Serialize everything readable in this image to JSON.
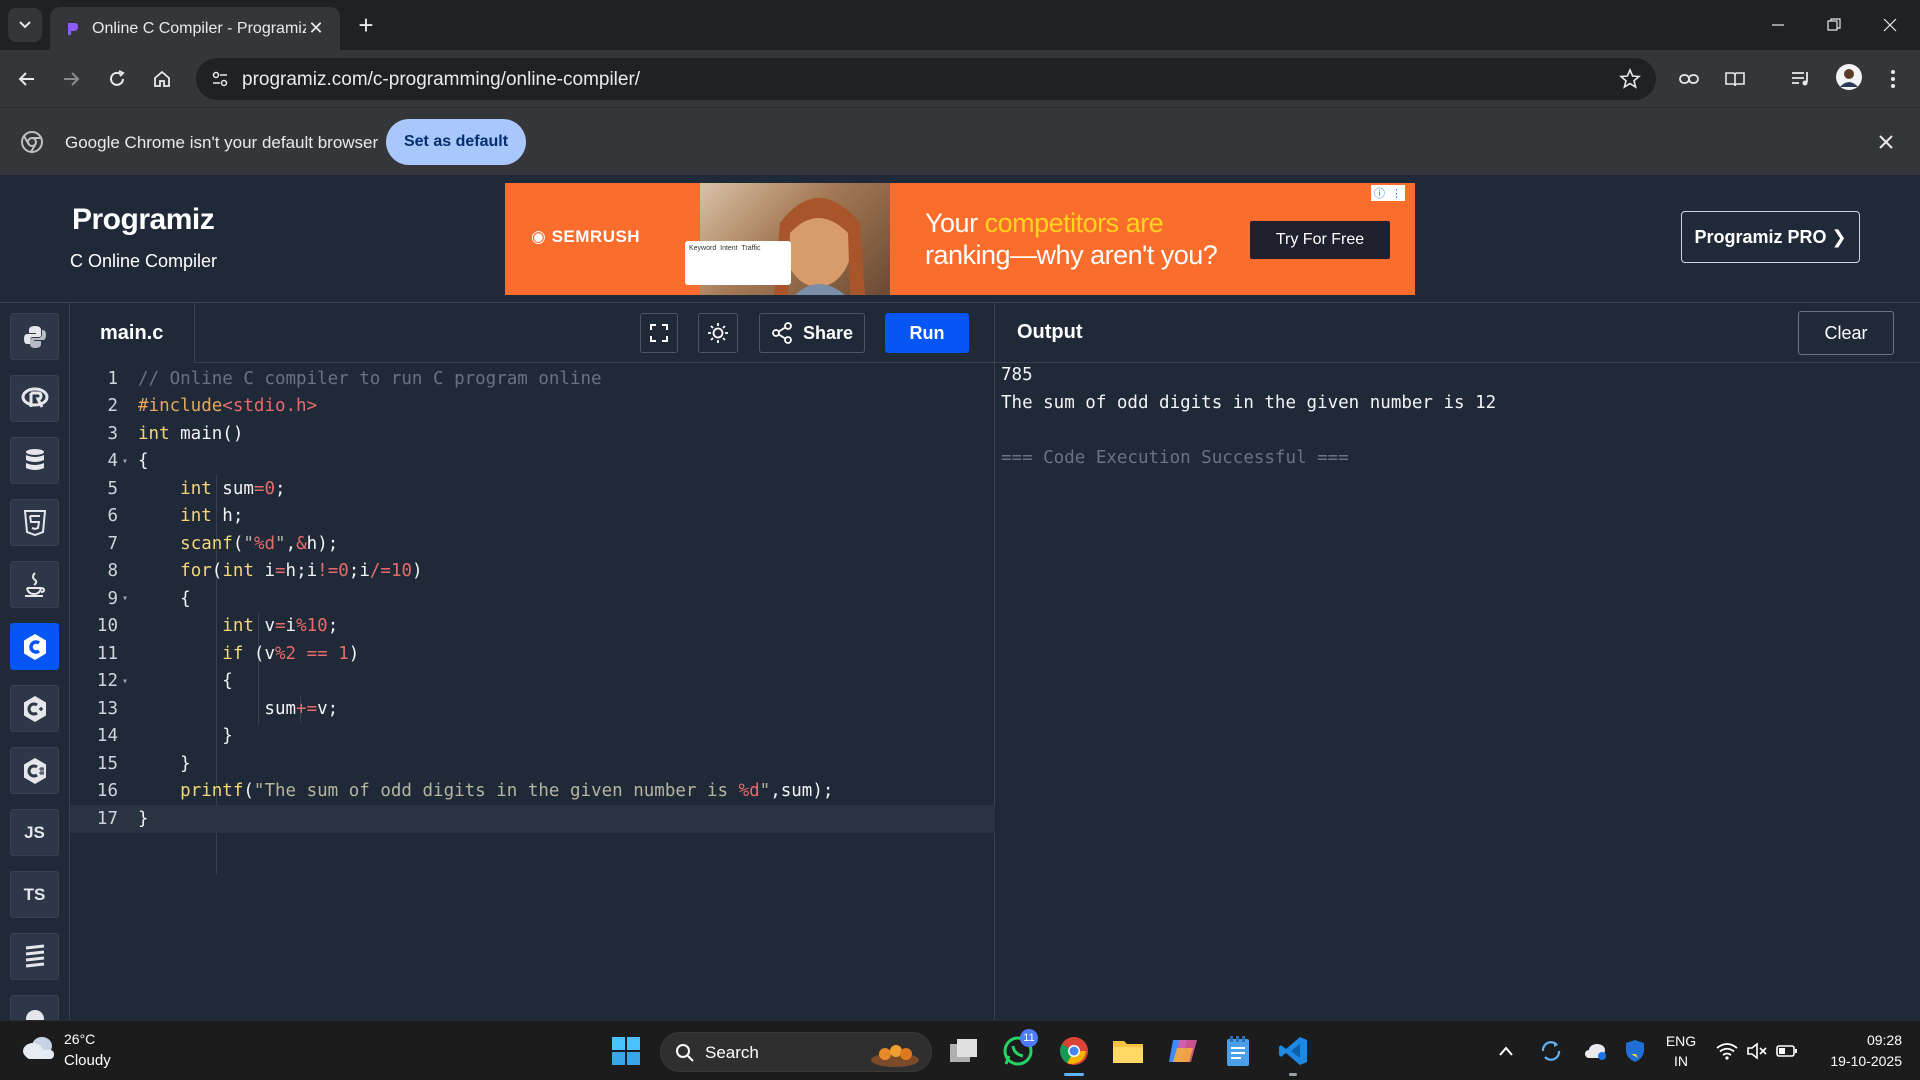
{
  "browser": {
    "tab_title": "Online C Compiler - Programiz",
    "url": "programiz.com/c-programming/online-compiler/",
    "infobar_text": "Google Chrome isn't your default browser",
    "infobar_button": "Set as default"
  },
  "site": {
    "logo": "Programiz",
    "subtitle": "C Online Compiler",
    "pro_button": "Programiz PRO ❯"
  },
  "ad": {
    "brand": "SEMRUSH",
    "headline_prefix": "Your ",
    "headline_highlight": "competitors are",
    "headline_rest": "ranking—why aren't you?",
    "cta": "Try For Free",
    "card_cols": [
      "Keyword",
      "Intent",
      "Traffic"
    ]
  },
  "rail": {
    "items": [
      {
        "name": "python",
        "label": ""
      },
      {
        "name": "r",
        "label": ""
      },
      {
        "name": "sql",
        "label": ""
      },
      {
        "name": "html",
        "label": ""
      },
      {
        "name": "java",
        "label": ""
      },
      {
        "name": "c",
        "label": ""
      },
      {
        "name": "cpp",
        "label": ""
      },
      {
        "name": "csharp",
        "label": ""
      },
      {
        "name": "js",
        "label": "JS"
      },
      {
        "name": "ts",
        "label": "TS"
      },
      {
        "name": "go",
        "label": ""
      }
    ],
    "active": "c"
  },
  "editor": {
    "filename": "main.c",
    "share_label": "Share",
    "run_label": "Run",
    "line_numbers": [
      "1",
      "2",
      "3",
      "4",
      "5",
      "6",
      "7",
      "8",
      "9",
      "10",
      "11",
      "12",
      "13",
      "14",
      "15",
      "16",
      "17"
    ]
  },
  "output": {
    "title": "Output",
    "clear_label": "Clear",
    "lines": [
      "785",
      "The sum of odd digits in the given number is 12",
      "",
      "=== Code Execution Successful ==="
    ]
  },
  "taskbar": {
    "temperature": "26°C",
    "weather": "Cloudy",
    "search_label": "Search",
    "whatsapp_badge": "11",
    "lang_top": "ENG",
    "lang_bottom": "IN",
    "time": "09:28",
    "date": "19-10-2025"
  }
}
